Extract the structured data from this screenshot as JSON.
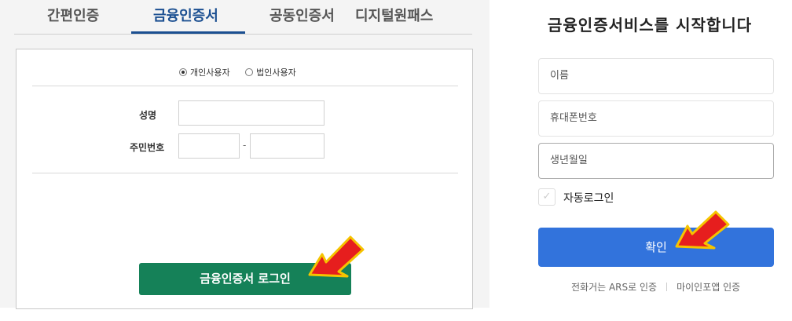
{
  "left_panel": {
    "tabs": [
      {
        "label": "간편인증"
      },
      {
        "label": "금융인증서"
      },
      {
        "label": "공동인증서"
      },
      {
        "label": "디지털원패스"
      }
    ],
    "user_type": {
      "options": [
        "개인사용자",
        "법인사용자"
      ],
      "selected": "개인사용자"
    },
    "form": {
      "name_label": "성명",
      "rrn_label": "주민번호",
      "rrn_separator": "-"
    },
    "login_button": "금융인증서 로그인"
  },
  "right_panel": {
    "title": "금융인증서비스를 시작합니다",
    "fields": {
      "name_placeholder": "이름",
      "phone_placeholder": "휴대폰번호",
      "birth_placeholder": "생년월일"
    },
    "auto_login_label": "자동로그인",
    "confirm_button": "확인",
    "links": [
      "전화거는 ARS로 인증",
      "마이인포앱 인증"
    ]
  },
  "colors": {
    "active_tab": "#1b4f91",
    "login_button": "#158158",
    "confirm_button": "#3273dc",
    "pointer_arrow": "#e61e1e"
  },
  "icons": [
    "radio-checked-icon",
    "radio-unchecked-icon",
    "checkmark-icon",
    "red-pointer-arrow-icon"
  ]
}
